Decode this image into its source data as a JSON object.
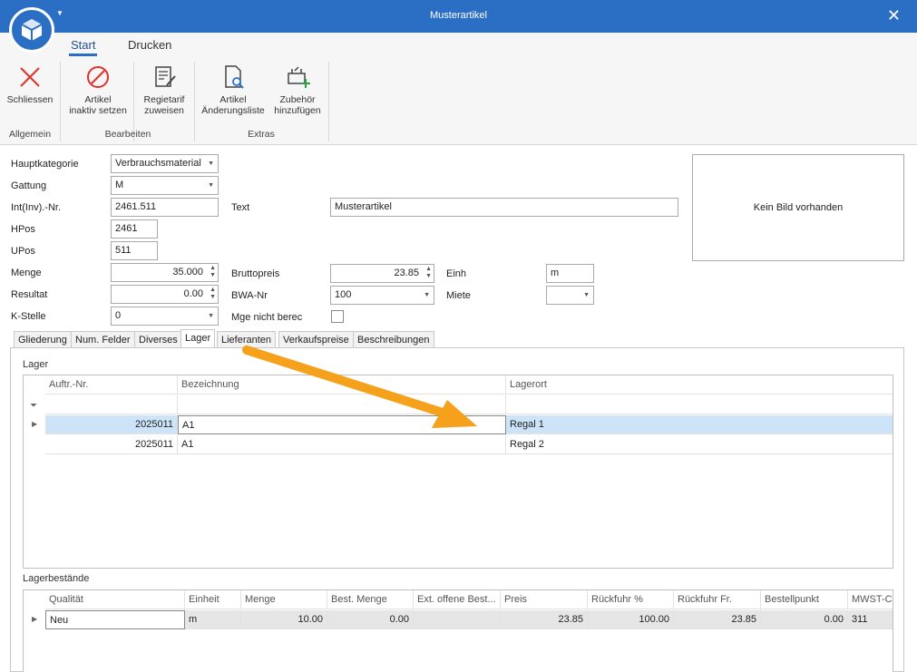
{
  "window": {
    "title": "Musterartikel"
  },
  "ribbon": {
    "tabs": [
      "Start",
      "Drucken"
    ],
    "buttons": {
      "close": "Schliessen",
      "inactive": "Artikel\ninaktiv setzen",
      "tarif": "Regietarif\nzuweisen",
      "changes": "Artikel\nÄnderungsliste",
      "accessory": "Zubehör\nhinzufügen"
    },
    "groups": {
      "allgemein": "Allgemein",
      "bearbeiten": "Bearbeiten",
      "extras": "Extras"
    }
  },
  "form": {
    "hauptkategorie": {
      "label": "Hauptkategorie",
      "value": "Verbrauchsmaterial"
    },
    "gattung": {
      "label": "Gattung",
      "value": "M"
    },
    "intnr": {
      "label": "Int(Inv).-Nr.",
      "value": "2461.511"
    },
    "text": {
      "label": "Text",
      "value": "Musterartikel"
    },
    "hpos": {
      "label": "HPos",
      "value": "2461"
    },
    "upos": {
      "label": "UPos",
      "value": "511"
    },
    "menge": {
      "label": "Menge",
      "value": "35.000"
    },
    "resultat": {
      "label": "Resultat",
      "value": "0.00"
    },
    "kstelle": {
      "label": "K-Stelle",
      "value": "0"
    },
    "bruttopreis": {
      "label": "Bruttopreis",
      "value": "23.85"
    },
    "bwanr": {
      "label": "BWA-Nr",
      "value": "100"
    },
    "mge": {
      "label": "Mge nicht berec"
    },
    "einh": {
      "label": "Einh",
      "value": "m"
    },
    "miete": {
      "label": "Miete",
      "value": ""
    },
    "image_placeholder": "Kein Bild vorhanden"
  },
  "detail_tabs": [
    "Gliederung",
    "Num. Felder",
    "Diverses",
    "Lager",
    "Lieferanten",
    "Verkaufspreise",
    "Beschreibungen"
  ],
  "lager": {
    "label": "Lager",
    "columns": [
      "Auftr.-Nr.",
      "Bezeichnung",
      "Lagerort"
    ],
    "rows": [
      {
        "auftr": "2025011",
        "bez": "A1",
        "ort": "Regal 1"
      },
      {
        "auftr": "2025011",
        "bez": "A1",
        "ort": "Regal 2"
      }
    ]
  },
  "bestand": {
    "label": "Lagerbestände",
    "columns": [
      "Qualität",
      "Einheit",
      "Menge",
      "Best. Menge",
      "Ext. offene Best...",
      "Preis",
      "Rückfuhr %",
      "Rückfuhr Fr.",
      "Bestellpunkt",
      "MWST-Co"
    ],
    "row": [
      "Neu",
      "m",
      "10.00",
      "0.00",
      "",
      "23.85",
      "100.00",
      "23.85",
      "0.00",
      "311"
    ]
  },
  "colors": {
    "titlebar": "#2b6fc4",
    "selected_row": "#cde3f7",
    "arrow": "#f5a11c"
  }
}
